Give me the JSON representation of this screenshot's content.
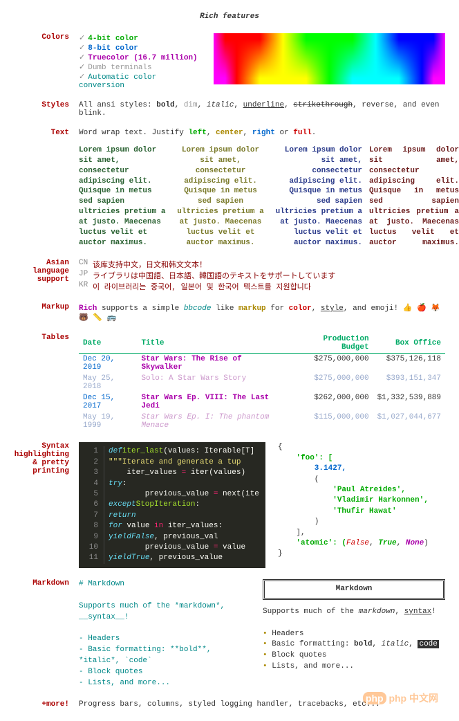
{
  "title": "Rich features",
  "colors": {
    "label": "Colors",
    "items": [
      "4-bit color",
      "8-bit color",
      "Truecolor (16.7 million)",
      "Dumb terminals",
      "Automatic color conversion"
    ]
  },
  "styles": {
    "label": "Styles",
    "prefix": "All ansi styles: ",
    "bold": "bold",
    "dim": "dim",
    "italic": "italic",
    "underline": "underline",
    "strike": "strikethrough",
    "suffix": ", reverse, and even blink."
  },
  "text": {
    "label": "Text",
    "prefix": "Word wrap text. Justify ",
    "left": "left",
    "center": "center",
    "right": "right",
    "full": "full",
    "lorem": "Lorem ipsum dolor sit amet, consectetur adipiscing elit. Quisque in metus sed sapien ultricies pretium a at justo. Maecenas luctus velit et auctor maximus."
  },
  "asian": {
    "label": "Asian language support",
    "cn_code": "CN",
    "cn": "该库支持中文，日文和韩文文本！",
    "jp_code": "JP",
    "jp": "ライブラリは中国語、日本語、韓国語のテキストをサポートしています",
    "kr_code": "KR",
    "kr": "이 라이브러리는 중국어, 일본어 및 한국어 텍스트를 지원합니다"
  },
  "markup": {
    "label": "Markup",
    "rich": "Rich",
    "t1": " supports a simple ",
    "bbcode": "bbcode",
    "t2": " like ",
    "markup_w": "markup",
    "t3": " for ",
    "color": "color",
    "style": "style",
    "t4": ", and emoji! 👍 🍎 🦊 🐻 📏 🚌"
  },
  "tables": {
    "label": "Tables",
    "headers": [
      "Date",
      "Title",
      "Production Budget",
      "Box Office"
    ],
    "rows": [
      {
        "date": "Dec 20, 2019",
        "title": "Star Wars: The Rise of Skywalker",
        "budget": "$275,000,000",
        "office": "$375,126,118",
        "dim": false,
        "italic": false
      },
      {
        "date": "May 25, 2018",
        "title": "Solo: A Star Wars Story",
        "budget": "$275,000,000",
        "office": "$393,151,347",
        "dim": true,
        "italic": false
      },
      {
        "date": "Dec 15, 2017",
        "title": "Star Wars Ep. VIII: The Last Jedi",
        "budget": "$262,000,000",
        "office": "$1,332,539,889",
        "dim": false,
        "italic": false
      },
      {
        "date": "May 19, 1999",
        "title": "Star Wars Ep. I: The phantom Menace",
        "budget": "$115,000,000",
        "office": "$1,027,044,677",
        "dim": true,
        "italic": true
      }
    ]
  },
  "syntax": {
    "label": "Syntax highlighting & pretty printing",
    "pretty": {
      "l1": "{",
      "l2": "    'foo': [",
      "l3": "        3.1427,",
      "l4": "        (",
      "l5": "            'Paul Atreides',",
      "l6": "            'Vladimir Harkonnen',",
      "l7": "            'Thufir Hawat'",
      "l8": "        )",
      "l9": "    ],",
      "l10a": "    'atomic': (",
      "false": "False",
      "true": "True",
      "none": "None",
      "l10b": ")",
      "l11": "}"
    }
  },
  "markdown": {
    "label": "Markdown",
    "src": {
      "l1": "# Markdown",
      "l2": "Supports much of the *markdown*, __syntax__!",
      "l3": "- Headers",
      "l4": "- Basic formatting: **bold**, *italic*, `code`",
      "l5": "- Block quotes",
      "l6": "- Lists, and more..."
    },
    "render": {
      "title": "Markdown",
      "p1a": "Supports much of the ",
      "p1b": "markdown",
      "p1c": ", ",
      "p1d": "syntax",
      "p1e": "!",
      "b1": "Headers",
      "b2a": "Basic formatting: ",
      "b2b": "bold",
      "b2c": "italic",
      "b2d": "code",
      "b3": "Block quotes",
      "b4": "Lists, and more..."
    }
  },
  "more": {
    "label": "+more!",
    "text": "Progress bars, columns, styled logging handler, tracebacks, etc..."
  },
  "watermark": "php 中文网"
}
